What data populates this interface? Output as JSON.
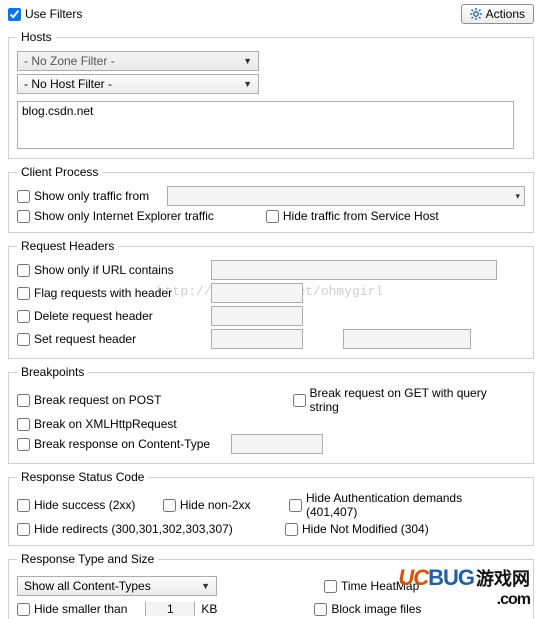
{
  "topbar": {
    "use_filters_label": "Use Filters",
    "actions_label": "Actions"
  },
  "hosts": {
    "legend": "Hosts",
    "zone_filter": "- No Zone Filter -",
    "host_filter": "- No Host Filter -",
    "hosts_text": "blog.csdn.net"
  },
  "client_process": {
    "legend": "Client Process",
    "show_only_traffic_from": "Show only traffic from",
    "show_ie": "Show only Internet Explorer traffic",
    "hide_service_host": "Hide traffic from Service Host"
  },
  "request_headers": {
    "legend": "Request Headers",
    "show_only_if": "Show only if URL contains",
    "flag_requests": "Flag requests with header",
    "delete_header": "Delete request header",
    "set_header": "Set request header",
    "watermark": "http://blog.csdn.net/ohmygirl"
  },
  "breakpoints": {
    "legend": "Breakpoints",
    "break_post": "Break request on POST",
    "break_get": "Break request on GET with query string",
    "break_xhr": "Break on XMLHttpRequest",
    "break_ct": "Break response on Content-Type"
  },
  "status_code": {
    "legend": "Response Status Code",
    "hide_2xx": "Hide success (2xx)",
    "hide_non2xx": "Hide non-2xx",
    "hide_auth": "Hide Authentication demands (401,407)",
    "hide_redirects": "Hide redirects (300,301,302,303,307)",
    "hide_notmod": "Hide Not Modified (304)"
  },
  "type_size": {
    "legend": "Response Type and Size",
    "show_all_ct": "Show all Content-Types",
    "time_heatmap": "Time HeatMap",
    "block_image": "Block image files",
    "hide_smaller": "Hide smaller than",
    "hide_smaller_value": "1",
    "unit": "KB"
  }
}
